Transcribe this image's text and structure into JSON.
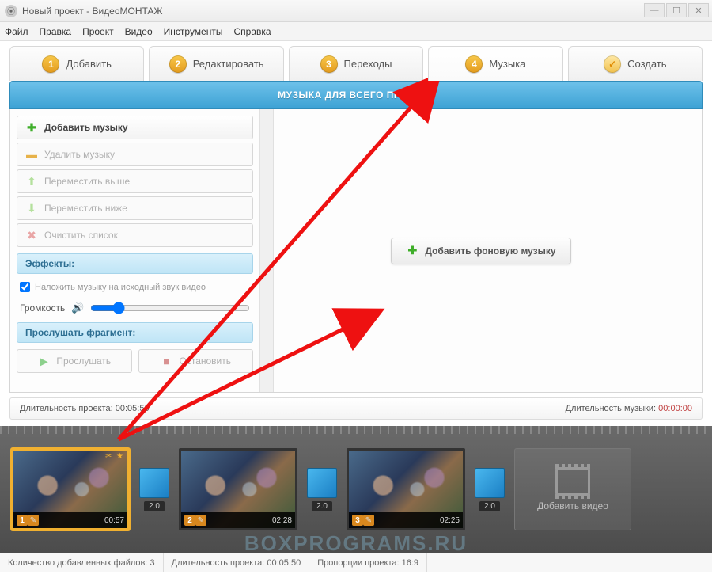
{
  "window": {
    "title": "Новый проект - ВидеоМОНТАЖ"
  },
  "menu": [
    "Файл",
    "Правка",
    "Проект",
    "Видео",
    "Инструменты",
    "Справка"
  ],
  "steps": [
    {
      "n": "1",
      "label": "Добавить"
    },
    {
      "n": "2",
      "label": "Редактировать"
    },
    {
      "n": "3",
      "label": "Переходы"
    },
    {
      "n": "4",
      "label": "Музыка"
    },
    {
      "n": "",
      "label": "Создать"
    }
  ],
  "section_header": "МУЗЫКА ДЛЯ ВСЕГО ПРОЕКТА",
  "left": {
    "add": "Добавить музыку",
    "del": "Удалить музыку",
    "up": "Переместить выше",
    "down": "Переместить ниже",
    "clear": "Очистить список",
    "fx": "Эффекты:",
    "overlay": "Наложить музыку на исходный звук видео",
    "volume": "Громкость",
    "listen_header": "Прослушать фрагмент:",
    "play": "Прослушать",
    "stop": "Остановить"
  },
  "right": {
    "add_bg": "Добавить фоновую музыку"
  },
  "info": {
    "proj_len_label": "Длительность проекта:",
    "proj_len": "00:05:50",
    "music_len_label": "Длительность музыки:",
    "music_len": "00:00:00"
  },
  "timeline": {
    "clips": [
      {
        "n": "1",
        "time": "00:57",
        "selected": true,
        "star": true
      },
      {
        "n": "2",
        "time": "02:28",
        "selected": false,
        "star": false
      },
      {
        "n": "3",
        "time": "02:25",
        "selected": false,
        "star": false
      }
    ],
    "transition": "2.0",
    "add_video": "Добавить видео"
  },
  "status": {
    "count_label": "Количество добавленных файлов:",
    "count": "3",
    "dur_label": "Длительность проекта:",
    "dur": "00:05:50",
    "ratio_label": "Пропорции проекта:",
    "ratio": "16:9"
  },
  "watermark": "BOXPROGRAMS.RU",
  "colors": {
    "accent": "#f0b030",
    "header": "#4aa9d6",
    "arrow": "#e11"
  }
}
